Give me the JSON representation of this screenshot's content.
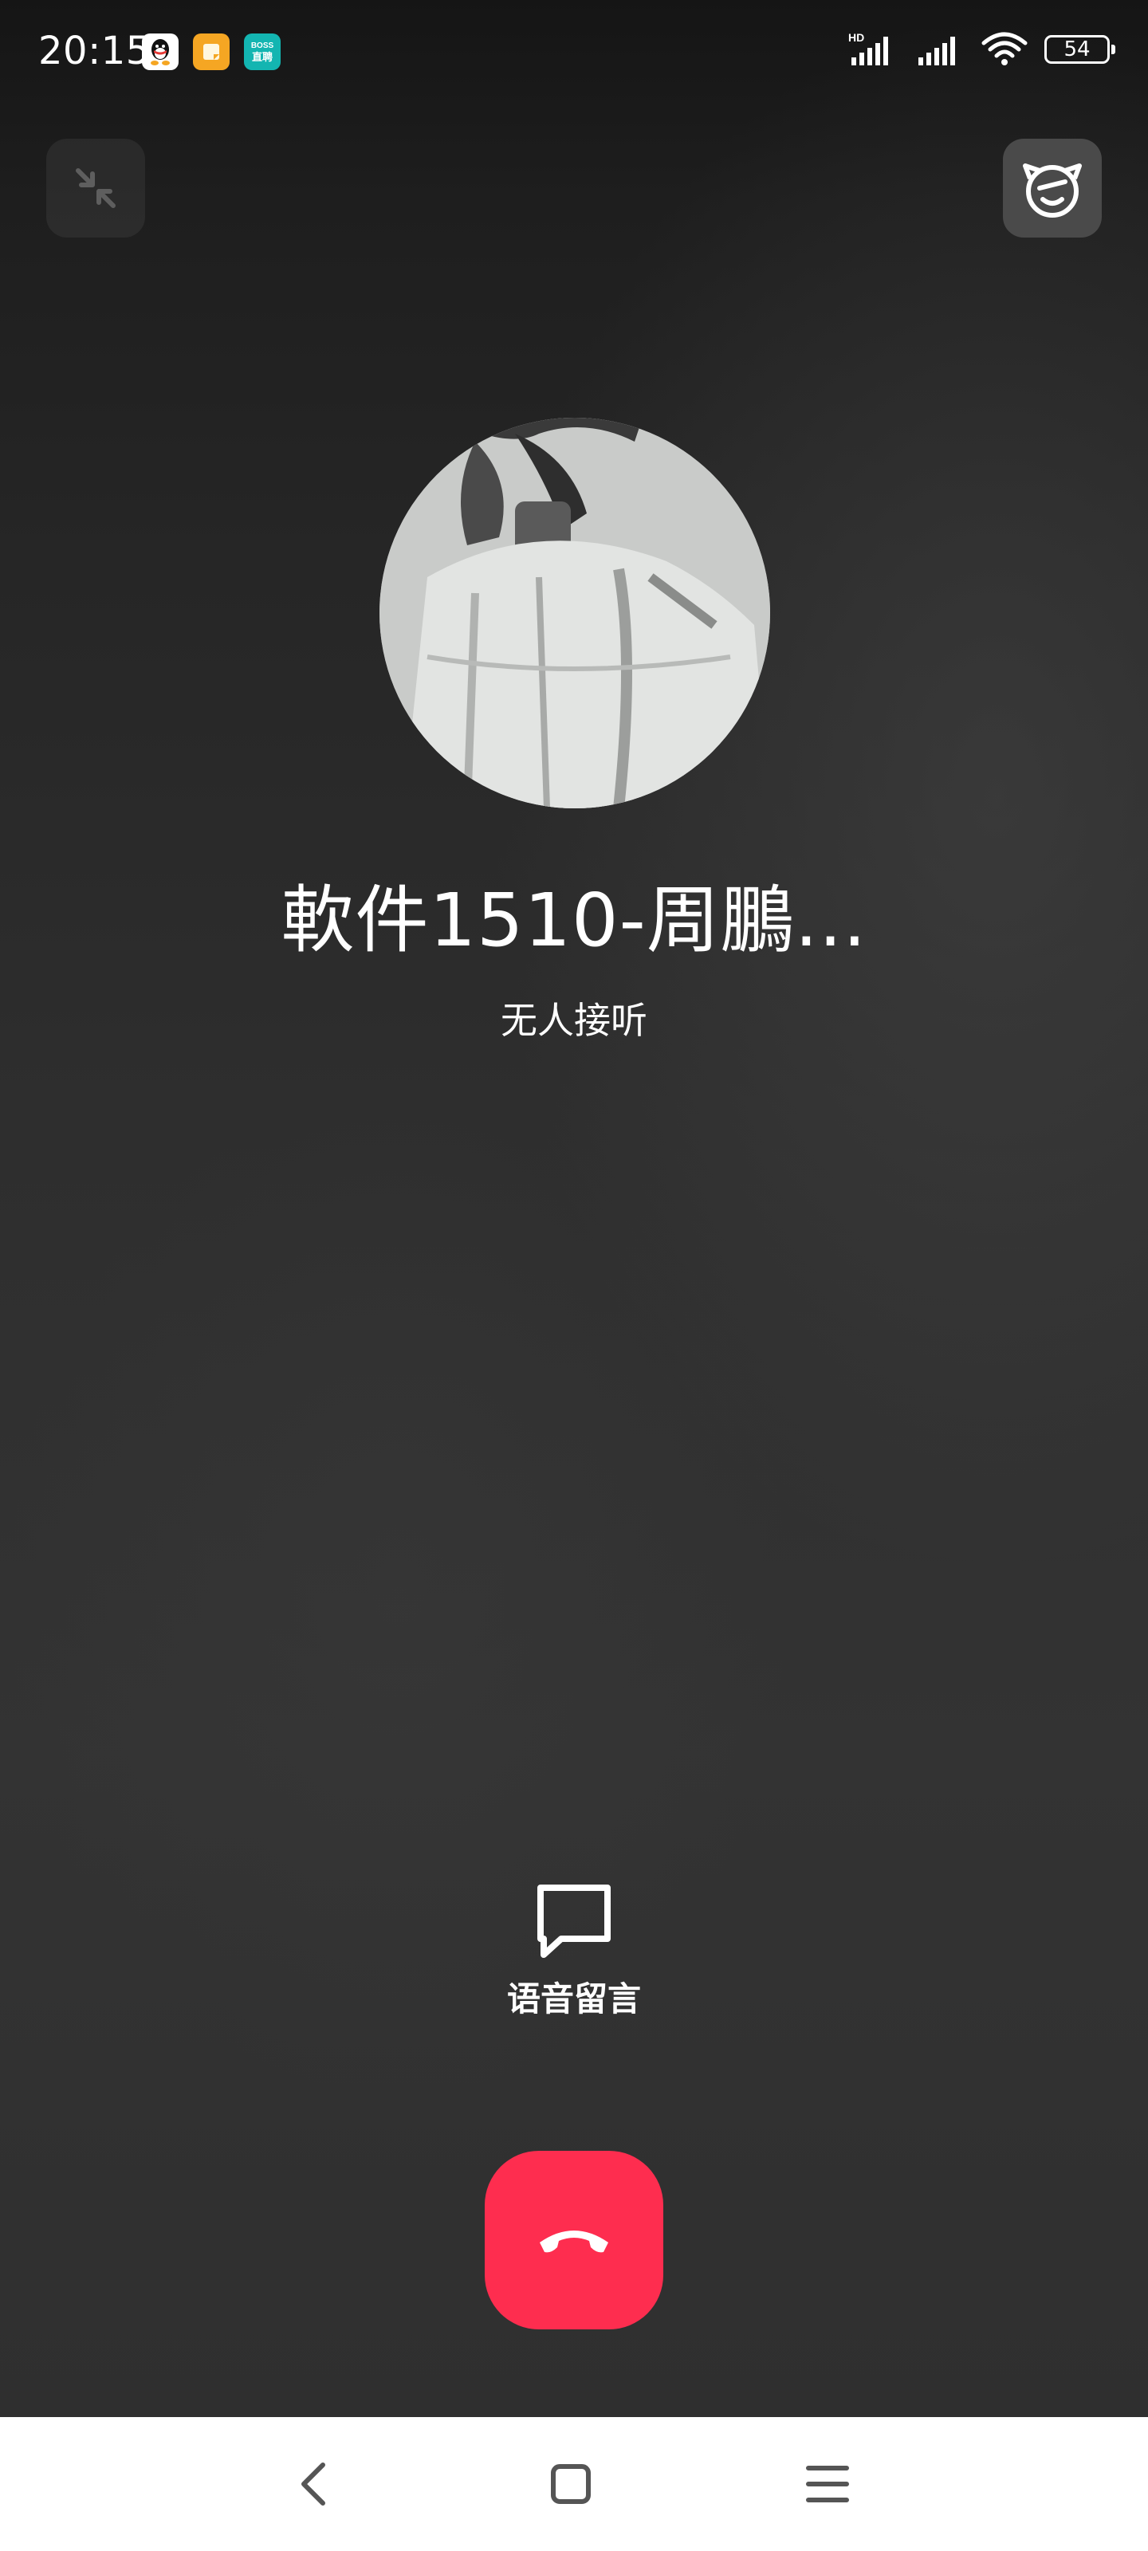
{
  "status_bar": {
    "time": "20:15",
    "notification_icons": [
      "qq-icon",
      "notes-icon",
      "boss-zhipin-icon"
    ],
    "boss_badge": "BOSS\n直聘",
    "network_label": "HD",
    "battery_level": "54"
  },
  "top_controls": {
    "minimize_icon": "minimize-arrows-icon",
    "effect_icon": "face-effect-icon"
  },
  "call": {
    "contact_name": "軟件1510-周鵬...",
    "status": "无人接听"
  },
  "actions": {
    "voice_message_label": "语音留言",
    "hangup_icon": "phone-hangup-icon"
  },
  "nav_bar": {
    "back_icon": "back-chevron-icon",
    "home_icon": "home-square-icon",
    "menu_icon": "menu-lines-icon"
  },
  "colors": {
    "hangup": "#fe2d4f",
    "text": "#ffffff",
    "background": "#2f2f2f",
    "nav_bar": "#ffffff"
  }
}
